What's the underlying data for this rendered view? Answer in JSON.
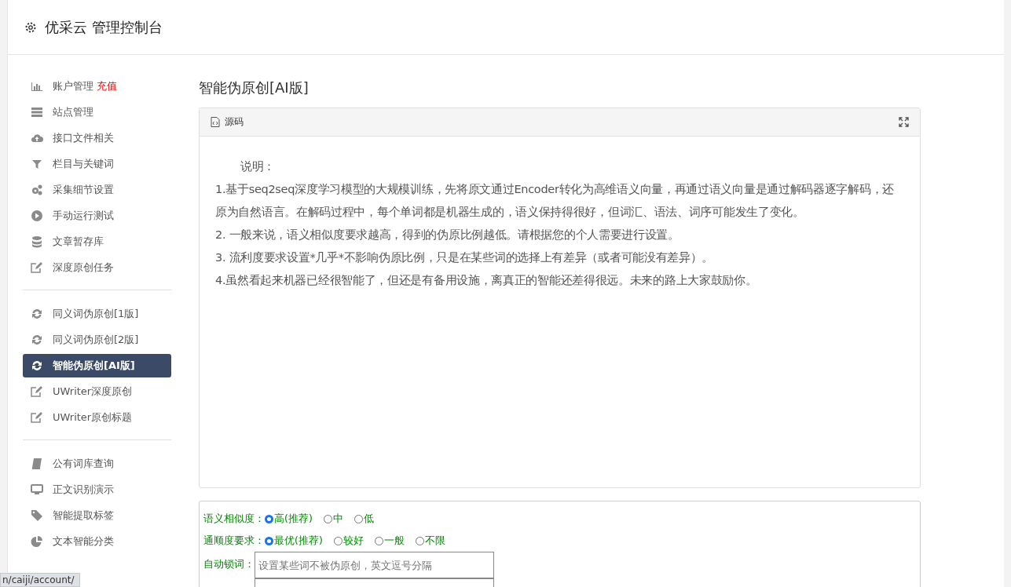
{
  "header": {
    "title": "优采云 管理控制台"
  },
  "sidebar": {
    "groups": [
      {
        "items": [
          {
            "label": "账户管理",
            "badge": "充值",
            "selected": false
          },
          {
            "label": "站点管理",
            "selected": false
          },
          {
            "label": "接口文件相关",
            "selected": false
          },
          {
            "label": "栏目与关键词",
            "selected": false
          },
          {
            "label": "采集细节设置",
            "selected": false
          },
          {
            "label": "手动运行测试",
            "selected": false
          },
          {
            "label": "文章暂存库",
            "selected": false
          },
          {
            "label": "深度原创任务",
            "selected": false
          }
        ]
      },
      {
        "items": [
          {
            "label": "同义词伪原创[1版]",
            "selected": false
          },
          {
            "label": "同义词伪原创[2版]",
            "selected": false
          },
          {
            "label": "智能伪原创[AI版]",
            "selected": true
          },
          {
            "label": "UWriter深度原创",
            "selected": false
          },
          {
            "label": "UWriter原创标题",
            "selected": false
          }
        ]
      },
      {
        "items": [
          {
            "label": "公有词库查询",
            "selected": false
          },
          {
            "label": "正文识别演示",
            "selected": false
          },
          {
            "label": "智能提取标签",
            "selected": false
          },
          {
            "label": "文本智能分类",
            "selected": false
          }
        ]
      }
    ]
  },
  "page_title": "智能伪原创[AI版]",
  "editor": {
    "toolbar_label": "源码",
    "paragraphs": [
      "说明：",
      "1.基于seq2seq深度学习模型的大规模训练，先将原文通过Encoder转化为高维语义向量，再通过语义向量是通过解码器逐字解码，还原为自然语言。在解码过程中，每个单词都是机器生成的，语义保持得很好，但词汇、语法、词序可能发生了变化。",
      "2. 一般来说，语义相似度要求越高，得到的伪原比例越低。请根据您的个人需要进行设置。",
      "3. 流利度要求设置*几乎*不影响伪原比例，只是在某些词的选择上有差异（或者可能没有差异）。",
      "4.虽然看起来机器已经很智能了，但还是有备用设施，离真正的智能还差得很远。未来的路上大家鼓励你。"
    ]
  },
  "form": {
    "radio_groups": [
      {
        "label": "语义相似度：",
        "options": [
          {
            "label": "高(推荐)",
            "selected": true
          },
          {
            "label": "中",
            "selected": false
          },
          {
            "label": "低",
            "selected": false
          }
        ]
      },
      {
        "label": "通顺度要求：",
        "options": [
          {
            "label": "最优(推荐)",
            "selected": true
          },
          {
            "label": "较好",
            "selected": false
          },
          {
            "label": "一般",
            "selected": false
          },
          {
            "label": "不限",
            "selected": false
          }
        ]
      }
    ],
    "lock_words": {
      "label": "自动锁词：",
      "placeholder": "设置某些词不被伪原创，英文逗号分隔"
    }
  },
  "status_url": "n/caiji/account/"
}
